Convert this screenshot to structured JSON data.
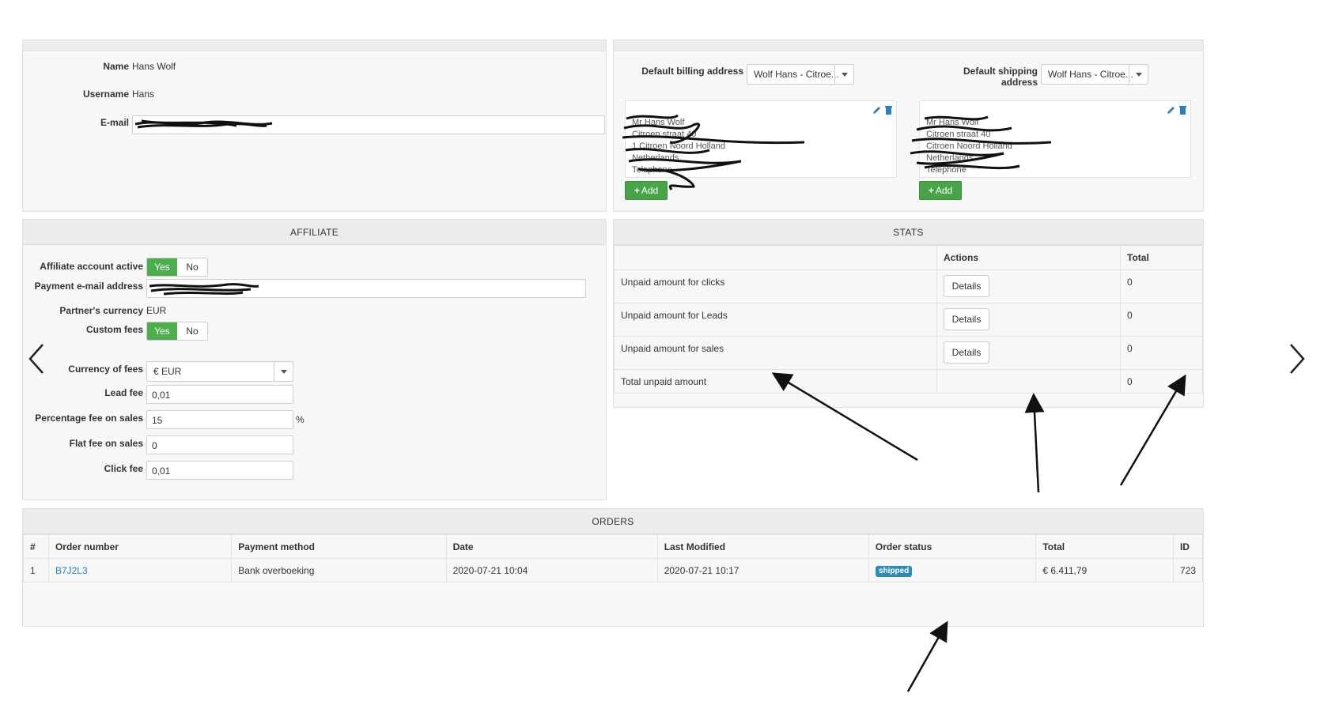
{
  "customer": {
    "name_label": "Name",
    "name_value": "Hans Wolf",
    "username_label": "Username",
    "username_value": "Hans",
    "email_label": "E-mail"
  },
  "addresses": {
    "billing_label": "Default billing address",
    "billing_selected": "Wolf Hans - Citroe...",
    "shipping_label": "Default shipping address",
    "shipping_selected": "Wolf Hans - Citroe...",
    "billing_card_lines": [
      "Mr Hans Wolf",
      "Citroen straat 40",
      "1 Citroen Noord Holland",
      "Netherlands",
      "Telephone"
    ],
    "shipping_card_lines": [
      "Mr Hans Wolf",
      "Citroen straat 40",
      "Citroen Noord Holland",
      "Netherlands",
      "Telephone"
    ],
    "add_label": "Add",
    "icons": [
      "pencil-icon",
      "trash-icon",
      "plus-icon"
    ]
  },
  "affiliate": {
    "title": "AFFILIATE",
    "account_active_label": "Affiliate account active",
    "payment_email_label": "Payment e-mail address",
    "partner_currency_label": "Partner's currency",
    "partner_currency_value": "EUR",
    "custom_fees_label": "Custom fees",
    "yes_label": "Yes",
    "no_label": "No",
    "currency_of_fees_label": "Currency of fees",
    "currency_of_fees_value": "€ EUR",
    "lead_fee_label": "Lead fee",
    "lead_fee_value": "0,01",
    "percentage_fee_label": "Percentage fee on sales",
    "percentage_fee_value": "15",
    "percent_sign": "%",
    "flat_fee_label": "Flat fee on sales",
    "flat_fee_value": "0",
    "click_fee_label": "Click fee",
    "click_fee_value": "0,01"
  },
  "stats": {
    "title": "STATS",
    "col_actions": "Actions",
    "col_total": "Total",
    "details_label": "Details",
    "rows": [
      {
        "label": "Unpaid amount for clicks",
        "total": "0"
      },
      {
        "label": "Unpaid amount for Leads",
        "total": "0"
      },
      {
        "label": "Unpaid amount for sales",
        "total": "0"
      },
      {
        "label": "Total unpaid amount",
        "total": "0"
      }
    ]
  },
  "orders": {
    "title": "ORDERS",
    "columns": [
      "#",
      "Order number",
      "Payment method",
      "Date",
      "Last Modified",
      "Order status",
      "Total",
      "ID"
    ],
    "rows": [
      {
        "index": "1",
        "order_number": "B7J2L3",
        "payment_method": "Bank overboeking",
        "date": "2020-07-21 10:04",
        "last_modified": "2020-07-21 10:17",
        "status": "shipped",
        "total": "€ 6.411,79",
        "id": "723"
      }
    ]
  },
  "colors": {
    "toggle_on": "#4cae4c",
    "add_button": "#47a447",
    "link": "#2a7fbf",
    "badge_shipped": "#2e8ab8",
    "edit_icon": "#2a7fbf"
  }
}
